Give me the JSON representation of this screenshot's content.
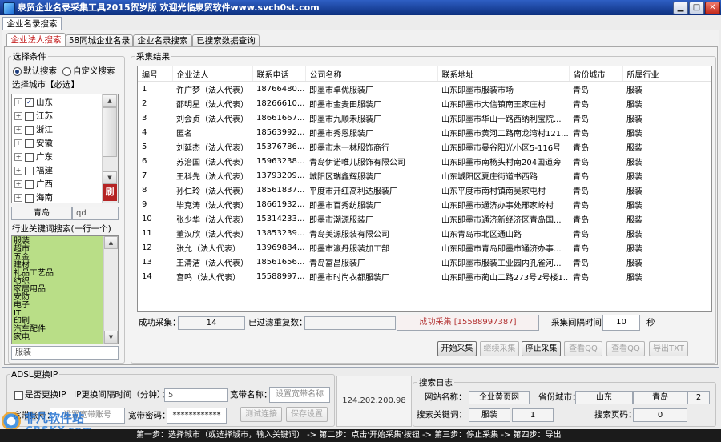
{
  "window": {
    "title": "泉贸企业名录采集工具2015贺岁版 欢迎光临泉贸软件www.svch0st.com",
    "minimize_glyph": "▁",
    "maximize_glyph": "□",
    "close_glyph": "✕"
  },
  "top_tab": "企业名录搜索",
  "sub_tabs": [
    {
      "label": "企业法人搜索",
      "active": true
    },
    {
      "label": "58同城企业名录",
      "active": false
    },
    {
      "label": "企业名录搜索",
      "active": false
    },
    {
      "label": "已搜索数据查询",
      "active": false
    }
  ],
  "conditions": {
    "title": "选择条件",
    "radio_default": "默认搜索",
    "radio_custom": "自定义搜索",
    "radio_selected": "默认搜索",
    "city_label": "选择城市【必选】",
    "cities": [
      {
        "label": "山东",
        "checked": true
      },
      {
        "label": "江苏",
        "checked": false
      },
      {
        "label": "浙江",
        "checked": false
      },
      {
        "label": "安徽",
        "checked": false
      },
      {
        "label": "广东",
        "checked": false
      },
      {
        "label": "福建",
        "checked": false
      },
      {
        "label": "广西",
        "checked": false
      },
      {
        "label": "海南",
        "checked": false
      }
    ],
    "refresh_label": "刷",
    "city_name_value": "青岛",
    "city_code_value": "qd",
    "keyword_label": "行业关键词搜索(一行一个)",
    "keywords": [
      "服装",
      "超市",
      "五金",
      "建材",
      "礼品工艺品",
      "纺织",
      "家居用品",
      "安防",
      "电子",
      "IT",
      "印刷",
      "汽车配件",
      "家电"
    ],
    "current_keyword": "服装"
  },
  "results": {
    "title": "采集结果",
    "columns": [
      "编号",
      "企业法人",
      "联系电话",
      "公司名称",
      "联系地址",
      "省份城市",
      "所属行业"
    ],
    "rows": [
      {
        "no": "1",
        "name": "许广梦（法人代表）",
        "phone": "18766480...",
        "company": "即墨市卓优服装厂",
        "address": "山东即墨市服装市场",
        "city": "青岛",
        "industry": "服装"
      },
      {
        "no": "2",
        "name": "邵明星（法人代表）",
        "phone": "18266610...",
        "company": "即墨市金麦田服装厂",
        "address": "山东即墨市大信镇南王家庄村",
        "city": "青岛",
        "industry": "服装"
      },
      {
        "no": "3",
        "name": "刘会贞（法人代表）",
        "phone": "18661667...",
        "company": "即墨市九顺禾服装厂",
        "address": "山东即墨市华山一路西纳利宝院...",
        "city": "青岛",
        "industry": "服装"
      },
      {
        "no": "4",
        "name": "匿名",
        "phone": "18563992...",
        "company": "即墨市秀恩服装厂",
        "address": "山东即墨市黄河二路南龙湾村121...",
        "city": "青岛",
        "industry": "服装"
      },
      {
        "no": "5",
        "name": "刘延杰（法人代表）",
        "phone": "15376786...",
        "company": "即墨市木一林服饰商行",
        "address": "山东即墨市曼谷阳光小区5-116号",
        "city": "青岛",
        "industry": "服装"
      },
      {
        "no": "6",
        "name": "苏治国（法人代表）",
        "phone": "15963238...",
        "company": "青岛伊诺唯儿服饰有限公司",
        "address": "山东即墨市南杨头村南204国道旁",
        "city": "青岛",
        "industry": "服装"
      },
      {
        "no": "7",
        "name": "王科先（法人代表）",
        "phone": "13793209...",
        "company": "城阳区瑞鑫辉服装厂",
        "address": "山东城阳区夏庄街道书西路",
        "city": "青岛",
        "industry": "服装"
      },
      {
        "no": "8",
        "name": "孙仁玲（法人代表）",
        "phone": "18561837...",
        "company": "平度市开红高利达服装厂",
        "address": "山东平度市南村镇南吴家屯村",
        "city": "青岛",
        "industry": "服装"
      },
      {
        "no": "9",
        "name": "毕克涛（法人代表）",
        "phone": "18661932...",
        "company": "即墨市百秀纺服装厂",
        "address": "山东即墨市通济办事处邢家岭村",
        "city": "青岛",
        "industry": "服装"
      },
      {
        "no": "10",
        "name": "张少华（法人代表）",
        "phone": "15314233...",
        "company": "即墨市潮源服装厂",
        "address": "山东即墨市通济新经济区青岛国...",
        "city": "青岛",
        "industry": "服装"
      },
      {
        "no": "11",
        "name": "董汉欣（法人代表）",
        "phone": "13853239...",
        "company": "青岛美源服装有限公司",
        "address": "山东青岛市北区通山路",
        "city": "青岛",
        "industry": "服装"
      },
      {
        "no": "12",
        "name": "张允（法人代表）",
        "phone": "13969884...",
        "company": "即墨市瀛丹服装加工部",
        "address": "山东即墨市青岛即墨市通济办事...",
        "city": "青岛",
        "industry": "服装"
      },
      {
        "no": "13",
        "name": "王清洁（法人代表）",
        "phone": "18561656...",
        "company": "青岛富昌服装厂",
        "address": "山东即墨市服装工业园内孔雀河...",
        "city": "青岛",
        "industry": "服装"
      },
      {
        "no": "14",
        "name": "宫鸣（法人代表）",
        "phone": "15588997...",
        "company": "即墨市时尚衣都服装厂",
        "address": "山东即墨市蔺山二路273号2号楼1...",
        "city": "青岛",
        "industry": "服装"
      }
    ],
    "success_label": "成功采集：",
    "success_count": "14",
    "filtered_label": "已过滤重复数：",
    "filtered_count": "",
    "status_text": "成功采集 [15588997387]",
    "interval_label": "采集间隔时间",
    "interval_value": "10",
    "interval_unit": "秒",
    "buttons": [
      {
        "label": "开始采集",
        "enabled": true
      },
      {
        "label": "继续采集",
        "enabled": false
      },
      {
        "label": "停止采集",
        "enabled": true
      },
      {
        "label": "查看QQ",
        "enabled": false
      },
      {
        "label": "查看QQ",
        "enabled": false
      },
      {
        "label": "导出TXT",
        "enabled": false
      }
    ]
  },
  "adsl": {
    "title": "ADSL更换IP",
    "change_ip_label": "是否更换IP",
    "change_ip_checked": false,
    "interval_label": "IP更换间隔时间（分钟）：",
    "interval_value": "5",
    "name_label": "宽带名称：",
    "name_placeholder": "设置宽带名称",
    "account_label": "宽带账号：",
    "account_placeholder": "设置宽带账号",
    "password_label": "宽带密码：",
    "password_value": "************",
    "test_button": "测试连接",
    "save_button": "保存设置"
  },
  "ip_display": "124.202.200.98",
  "log": {
    "title": "搜索日志",
    "site_label": "网站名称：",
    "site_value": "企业黄页网",
    "city_label": "省份城市：",
    "province_value": "山东",
    "city_value": "青岛",
    "city_count": "2",
    "keyword_label": "搜素关键词：",
    "keyword_value": "服装",
    "keyword_count": "1",
    "page_label": "搜索页码：",
    "page_value": "0"
  },
  "status_bar": "第一步：选择城市（或选择城市，输入关键词） -> 第二步：点击'开始采集'按钮 -> 第三步：停止采集 -> 第四步：导出",
  "watermark": {
    "line1": "非凡软件站",
    "line2": "CRSKY.com"
  },
  "colors": {
    "titlebar": "#0c2f7e",
    "close_button": "#c32a1c",
    "keyword_background": "#b9de87",
    "refresh_button": "#b52424",
    "status_text": "#b23030",
    "active_tab_text": "#c21616"
  }
}
